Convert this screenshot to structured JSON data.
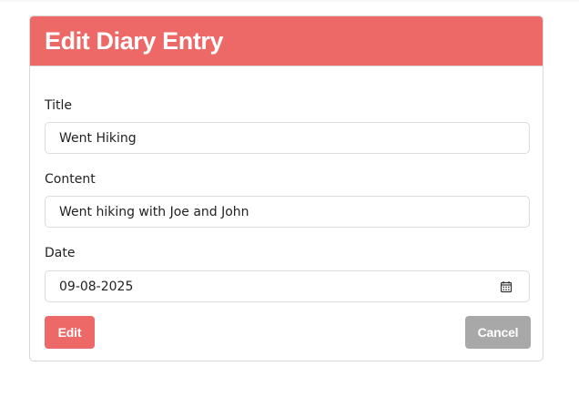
{
  "form": {
    "title": "Edit Diary Entry",
    "fields": {
      "title": {
        "label": "Title",
        "value": "Went Hiking"
      },
      "content": {
        "label": "Content",
        "value": "Went hiking with Joe and John"
      },
      "date": {
        "label": "Date",
        "value": "09-08-2025",
        "icon": "calendar-icon"
      }
    },
    "buttons": {
      "edit": "Edit",
      "cancel": "Cancel"
    }
  },
  "colors": {
    "accent": "#ec6967",
    "cancel": "#a8a8a8",
    "border": "#dcdcdc"
  }
}
